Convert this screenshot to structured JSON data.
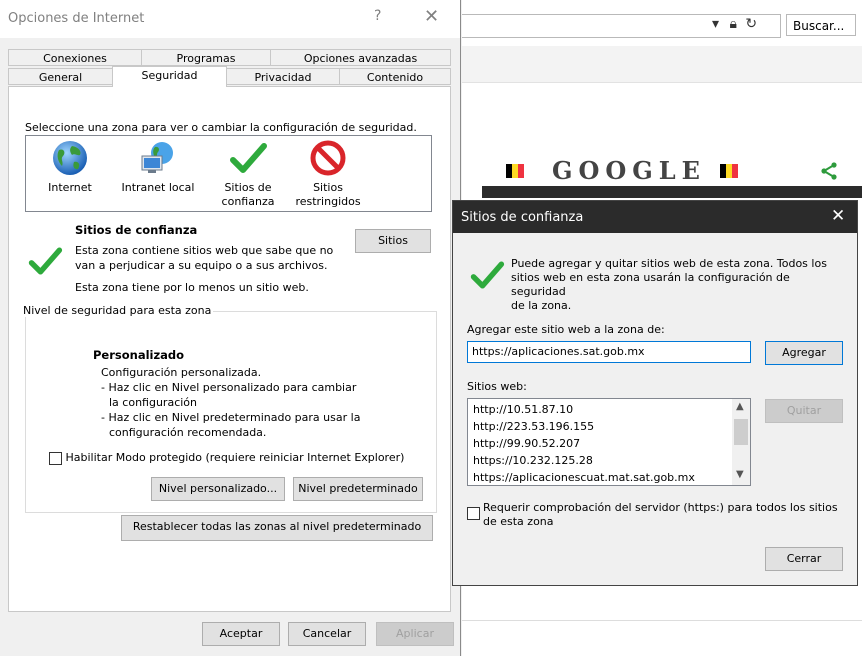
{
  "browser": {
    "search_placeholder": "Buscar...",
    "doodle_text": "GOOGLE"
  },
  "ie_dialog": {
    "title": "Opciones de Internet",
    "help_glyph": "?",
    "close_glyph": "✕",
    "tabs_row1": [
      "Conexiones",
      "Programas",
      "Opciones avanzadas"
    ],
    "tabs_row2": [
      "General",
      "Seguridad",
      "Privacidad",
      "Contenido"
    ],
    "active_tab": "Seguridad",
    "zone_prompt": "Seleccione una zona para ver o cambiar la configuración de seguridad.",
    "zones": [
      {
        "label_1": "Internet",
        "label_2": "",
        "icon": "globe-icon"
      },
      {
        "label_1": "Intranet local",
        "label_2": "",
        "icon": "network-icon"
      },
      {
        "label_1": "Sitios de",
        "label_2": "confianza",
        "icon": "checkmark-icon"
      },
      {
        "label_1": "Sitios",
        "label_2": "restringidos",
        "icon": "restricted-icon"
      }
    ],
    "selected_zone": "Sitios de confianza",
    "zone_title": "Sitios de confianza",
    "zone_desc_1": "Esta zona contiene sitios web que sabe que no",
    "zone_desc_2": "van a perjudicar a su equipo o a sus archivos.",
    "zone_min": "Esta zona tiene por lo menos un sitio web.",
    "sites_button": "Sitios",
    "level_legend": "Nivel de seguridad para esta zona",
    "level_title": "Personalizado",
    "level_lines": [
      "Configuración personalizada.",
      "- Haz clic en Nivel personalizado para cambiar",
      "la configuración",
      "- Haz clic en Nivel predeterminado para usar la",
      "configuración recomendada."
    ],
    "protected_mode": "Habilitar Modo protegido (requiere reiniciar Internet Explorer)",
    "custom_level_button": "Nivel personalizado...",
    "default_level_button": "Nivel predeterminado",
    "reset_button": "Restablecer todas las zonas al nivel predeterminado",
    "ok_button": "Aceptar",
    "cancel_button": "Cancelar",
    "apply_button": "Aplicar"
  },
  "trusted_dialog": {
    "title": "Sitios de confianza",
    "close_glyph": "✕",
    "info_1": "Puede agregar y quitar sitios web de esta zona. Todos los",
    "info_2": "sitios web en esta zona usarán la configuración de seguridad",
    "info_3": "de la zona.",
    "add_label": "Agregar este sitio web a la zona de:",
    "url_value": "https://aplicaciones.sat.gob.mx",
    "add_button": "Agregar",
    "sites_label": "Sitios web:",
    "sites": [
      "http://10.51.87.10",
      "http://223.53.196.155",
      "http://99.90.52.207",
      "https://10.232.125.28",
      "https://aplicacionescuat.mat.sat.gob.mx"
    ],
    "remove_button": "Quitar",
    "require_https_1": "Requerir comprobación del servidor (https:) para todos los sitios",
    "require_https_2": "de esta zona",
    "close_button": "Cerrar"
  },
  "colors": {
    "accent": "#0078d7",
    "check_green": "#2eaa3c",
    "restricted_red": "#d9252a"
  }
}
